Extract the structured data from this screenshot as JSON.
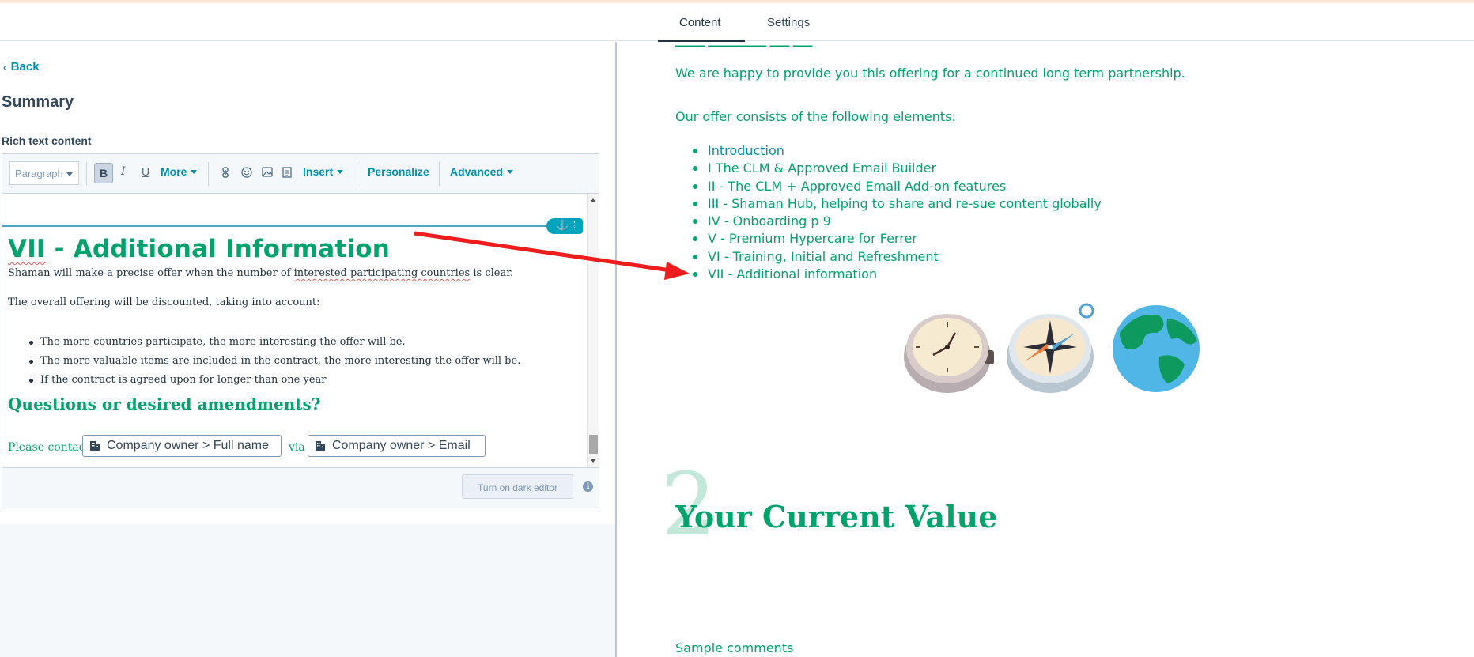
{
  "tabs": {
    "content": "Content",
    "settings": "Settings"
  },
  "sidebar": {
    "back": "Back",
    "title": "Summary",
    "field_label": "Rich text content"
  },
  "toolbar": {
    "paragraph": "Paragraph",
    "bold": "B",
    "italic": "I",
    "underline": "U",
    "more": "More",
    "insert": "Insert",
    "personalize": "Personalize",
    "advanced": "Advanced"
  },
  "editor": {
    "heading_part1": "VII",
    "heading_part2": " - Additional Information",
    "para1_a": "Shaman will make a precise offer when the number of ",
    "para1_b": "interested participating countries",
    "para1_c": " is clear.",
    "para2": "The overall offering will be discounted, taking into account:",
    "bullets": [
      "The more countries participate, the more interesting the offer will be.",
      "The more valuable items are included in the contract, the more interesting the offer will be.",
      "If the contract is agreed upon for longer than one year"
    ],
    "subheading": "Questions or desired amendments?",
    "contact_prefix": "Please contact",
    "token1": "Company owner > Full name",
    "via": "via",
    "token2": "Company owner > Email",
    "dark_button": "Turn on dark editor",
    "info": "i"
  },
  "preview": {
    "intro": "We are happy to provide you this offering for a continued long term partnership.",
    "offer_lead": "Our offer consists of the following elements:",
    "toc": [
      "Introduction",
      "I  The CLM & Approved Email Builder",
      "II - The CLM + Approved Email Add-on features",
      "III - Shaman Hub, helping to share and re-sue content globally",
      "IV - Onboarding p 9",
      "V - Premium Hypercare for Ferrer",
      "VI - Training, Initial and Refreshment",
      "VII - Additional information"
    ],
    "section_number": "2",
    "section_title": "Your Current Value",
    "sample": "Sample comments"
  },
  "colors": {
    "accent_green": "#00a36b",
    "link_teal": "#0091ae",
    "annotation_arrow": "#ee1c1c"
  }
}
